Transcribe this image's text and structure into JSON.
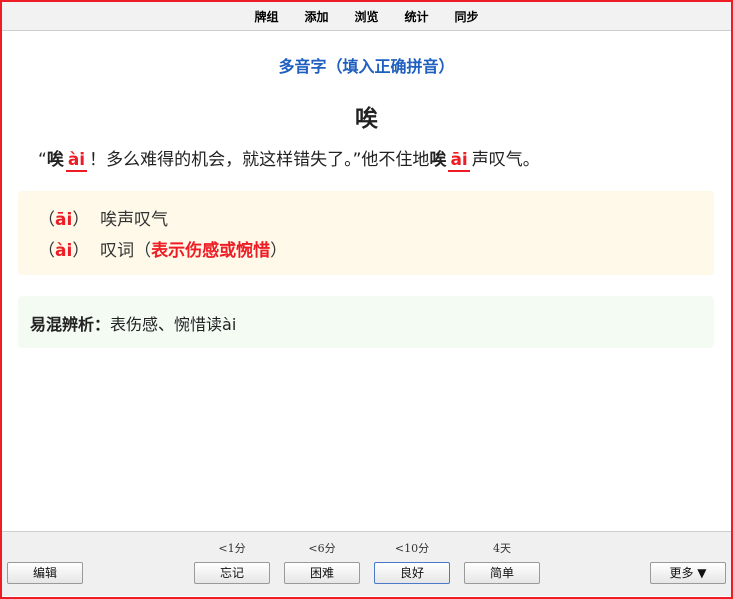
{
  "topbar": {
    "items": [
      "牌组",
      "添加",
      "浏览",
      "统计",
      "同步"
    ]
  },
  "card": {
    "heading": "多音字（填入正确拼音）",
    "character": "唉",
    "sentence": {
      "open_quote": "“",
      "word1": "唉",
      "pinyin1": "ài",
      "middle": "！多么难得的机会，就这样错失了。”他不住地",
      "word2": "唉",
      "pinyin2": "āi",
      "end": "声叹气。"
    },
    "definitions": [
      {
        "paren_open": "（",
        "pinyin": "āi",
        "paren_close": "）",
        "meaning": "唉声叹气",
        "note_open": "",
        "note": "",
        "note_close": ""
      },
      {
        "paren_open": "（",
        "pinyin": "ài",
        "paren_close": "）",
        "meaning": "叹词",
        "note_open": "（",
        "note": "表示伤感或惋惜",
        "note_close": "）"
      }
    ],
    "tip": {
      "label": "易混辨析：",
      "text": "表伤感、惋惜读ài"
    }
  },
  "bottombar": {
    "edit_label": "编辑",
    "more_label": "更多 ▼",
    "answers": [
      {
        "interval": "<1分",
        "label": "忘记"
      },
      {
        "interval": "<6分",
        "label": "困难"
      },
      {
        "interval": "<10分",
        "label": "良好"
      },
      {
        "interval": "4天",
        "label": "简单"
      }
    ]
  },
  "colors": {
    "accent_border": "#ee1c24",
    "heading_blue": "#1f5fbf",
    "pinyin_red": "#ee1c24",
    "definition_bg": "#fff9ea",
    "tip_bg": "#f3fbf3"
  }
}
